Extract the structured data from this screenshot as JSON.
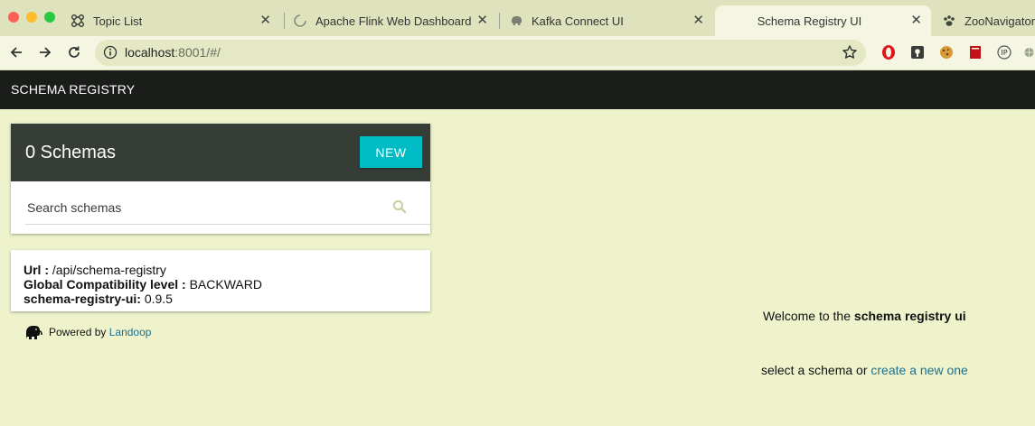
{
  "browser": {
    "tabs": [
      {
        "label": "Topic List",
        "icon": "grid-icon"
      },
      {
        "label": "Apache Flink Web Dashboard",
        "icon": "loading-icon"
      },
      {
        "label": "Kafka Connect UI",
        "icon": "elephant-icon"
      },
      {
        "label": "Schema Registry UI",
        "icon": "none",
        "active": true
      },
      {
        "label": "ZooNavigator",
        "icon": "paw-icon"
      }
    ],
    "address": {
      "host": "localhost",
      "rest": ":8001/#/"
    },
    "extensions": [
      "opera-icon",
      "keyhole-icon",
      "cookie-icon",
      "book-icon",
      "ip-icon",
      "globe-icon"
    ]
  },
  "app": {
    "brand": "SCHEMA REGISTRY"
  },
  "schemas": {
    "count_label": "0 Schemas",
    "new_button": "NEW",
    "search_placeholder": "Search schemas"
  },
  "info": {
    "url_label": "Url :",
    "url_value": " /api/schema-registry",
    "compat_label": "Global Compatibility level :",
    "compat_value": " BACKWARD",
    "version_label": "schema-registry-ui:",
    "version_value": " 0.9.5"
  },
  "footer": {
    "powered_text": "Powered by ",
    "powered_link": "Landoop"
  },
  "welcome": {
    "prefix": "Welcome to the ",
    "app_name": "schema registry ui",
    "select_prefix": "select a schema or ",
    "create_link": "create a new one"
  },
  "colors": {
    "accent": "#00bcc5",
    "navbar": "#1a1d1a",
    "card_header": "#363c36",
    "page_bg": "#eff3cc",
    "link": "#1e6f8c"
  }
}
